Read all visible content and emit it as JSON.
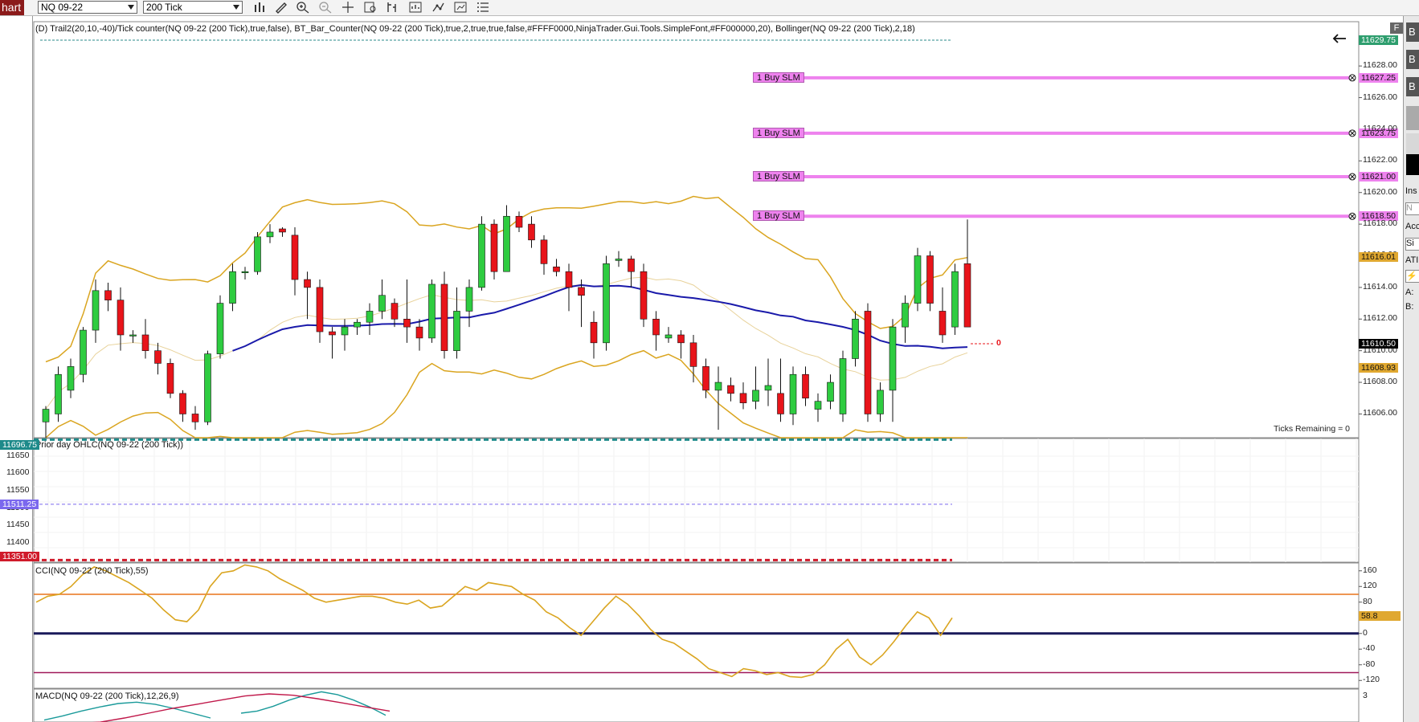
{
  "toolbar": {
    "tab_label": "hart",
    "instrument": "NQ 09-22",
    "interval": "200 Tick"
  },
  "main_panel": {
    "legend": "(D) Trail2(20,10,-40)/Tick counter(NQ 09-22 (200 Tick),true,false), BT_Bar_Counter(NQ 09-22 (200 Tick),true,2,true,true,false,#FFFF0000,NinjaTrader.Gui.Tools.SimpleFont,#FF000000,20), Bollinger(NQ 09-22 (200 Tick),2,18)",
    "ticks_remaining": "Ticks Remaining = 0",
    "bar_counter": "0",
    "orders": [
      {
        "label": "1 Buy SLM",
        "price": 11627.25,
        "tag": "11627.25"
      },
      {
        "label": "1 Buy SLM",
        "price": 11623.75,
        "tag": "11623.75"
      },
      {
        "label": "1 Buy SLM",
        "price": 11621.0,
        "tag": "11621.00"
      },
      {
        "label": "1 Buy SLM",
        "price": 11618.5,
        "tag": "11618.50"
      }
    ],
    "price_tags": {
      "top": "11629.75",
      "upper_band": "11616.01",
      "last": "11610.50",
      "lower_band": "11608.93"
    },
    "axis_ticks": [
      "11628.00",
      "11626.00",
      "11624.00",
      "11622.00",
      "11620.00",
      "11618.00",
      "11616.00",
      "11614.00",
      "11612.00",
      "11610.00",
      "11608.00",
      "11606.00"
    ],
    "colors": {
      "up": "#2ecc40",
      "down": "#e8141a",
      "band": "#daa520",
      "ma": "#1a1aaa",
      "order_line": "#ee82ee"
    }
  },
  "ohlc_panel": {
    "legend": "Prior day OHLC(NQ 09-22 (200 Tick))",
    "tags": {
      "high": "11696.75",
      "mid": "11511.25",
      "low": "11351.00"
    },
    "axis_ticks": [
      "11650",
      "11600",
      "11550",
      "11500",
      "11450",
      "11400"
    ]
  },
  "cci_panel": {
    "legend": "CCI(NQ 09-22 (200 Tick),55)",
    "value_tag": "58.8",
    "axis_ticks": [
      "160",
      "120",
      "80",
      "40",
      "0",
      "-40",
      "-80",
      "-120"
    ]
  },
  "macd_panel": {
    "legend": "MACD(NQ 09-22 (200 Tick),12,26,9)",
    "axis_ticks": [
      "3"
    ]
  },
  "right_panel": {
    "buttons": [
      "B",
      "B",
      "B"
    ],
    "labels": [
      "Ins",
      "N",
      "Acc",
      "Si",
      "ATI",
      "A:",
      "B:"
    ]
  },
  "chart_data": {
    "type": "candlestick",
    "candles": [
      {
        "o": 11605.5,
        "h": 11606.5,
        "l": 11604.5,
        "c": 11606.3
      },
      {
        "o": 11606,
        "h": 11609,
        "l": 11605.5,
        "c": 11608.5
      },
      {
        "o": 11607.5,
        "h": 11609.5,
        "l": 11607,
        "c": 11609
      },
      {
        "o": 11608.5,
        "h": 11611.5,
        "l": 11608,
        "c": 11611.3
      },
      {
        "o": 11611.3,
        "h": 11614.5,
        "l": 11610.5,
        "c": 11613.8
      },
      {
        "o": 11613.8,
        "h": 11614.3,
        "l": 11612.5,
        "c": 11613.2
      },
      {
        "o": 11613.2,
        "h": 11614,
        "l": 11610,
        "c": 11611
      },
      {
        "o": 11611,
        "h": 11611.3,
        "l": 11610.5,
        "c": 11611
      },
      {
        "o": 11611,
        "h": 11612,
        "l": 11609.5,
        "c": 11610
      },
      {
        "o": 11610,
        "h": 11610.5,
        "l": 11608.5,
        "c": 11609.2
      },
      {
        "o": 11609.2,
        "h": 11609.5,
        "l": 11607,
        "c": 11607.3
      },
      {
        "o": 11607.3,
        "h": 11607.5,
        "l": 11605.5,
        "c": 11606
      },
      {
        "o": 11606,
        "h": 11606.5,
        "l": 11605,
        "c": 11605.5
      },
      {
        "o": 11605.5,
        "h": 11610,
        "l": 11605.3,
        "c": 11609.8
      },
      {
        "o": 11609.8,
        "h": 11613.5,
        "l": 11609.5,
        "c": 11613
      },
      {
        "o": 11613,
        "h": 11615.5,
        "l": 11612.5,
        "c": 11615
      },
      {
        "o": 11615,
        "h": 11615.3,
        "l": 11614.5,
        "c": 11615
      },
      {
        "o": 11615,
        "h": 11617.5,
        "l": 11614.8,
        "c": 11617.2
      },
      {
        "o": 11617.2,
        "h": 11618,
        "l": 11616.8,
        "c": 11617.5
      },
      {
        "o": 11617.7,
        "h": 11617.8,
        "l": 11617.2,
        "c": 11617.5
      },
      {
        "o": 11617.3,
        "h": 11617.8,
        "l": 11613.5,
        "c": 11614.5
      },
      {
        "o": 11614.5,
        "h": 11615,
        "l": 11612,
        "c": 11614
      },
      {
        "o": 11614,
        "h": 11614.5,
        "l": 11610.5,
        "c": 11611.2
      },
      {
        "o": 11611.2,
        "h": 11611.5,
        "l": 11609.5,
        "c": 11611
      },
      {
        "o": 11611,
        "h": 11612,
        "l": 11610,
        "c": 11611.5
      },
      {
        "o": 11611.5,
        "h": 11612,
        "l": 11611,
        "c": 11611.8
      },
      {
        "o": 11611.8,
        "h": 11613,
        "l": 11611,
        "c": 11612.5
      },
      {
        "o": 11612.5,
        "h": 11614.5,
        "l": 11612,
        "c": 11613.5
      },
      {
        "o": 11613,
        "h": 11613.3,
        "l": 11611.5,
        "c": 11612
      },
      {
        "o": 11612,
        "h": 11614.5,
        "l": 11610.5,
        "c": 11611.5
      },
      {
        "o": 11611.5,
        "h": 11612,
        "l": 11610,
        "c": 11610.8
      },
      {
        "o": 11610.8,
        "h": 11614.5,
        "l": 11610.5,
        "c": 11614.2
      },
      {
        "o": 11614.2,
        "h": 11615,
        "l": 11609.5,
        "c": 11610
      },
      {
        "o": 11610,
        "h": 11614,
        "l": 11609.5,
        "c": 11612.5
      },
      {
        "o": 11612.5,
        "h": 11614.5,
        "l": 11611.5,
        "c": 11614
      },
      {
        "o": 11614,
        "h": 11618.5,
        "l": 11613.8,
        "c": 11618
      },
      {
        "o": 11618,
        "h": 11618.3,
        "l": 11614.5,
        "c": 11615
      },
      {
        "o": 11615,
        "h": 11619.2,
        "l": 11615,
        "c": 11618.5
      },
      {
        "o": 11618.5,
        "h": 11618.8,
        "l": 11617.5,
        "c": 11617.8
      },
      {
        "o": 11618,
        "h": 11618.5,
        "l": 11616.5,
        "c": 11617
      },
      {
        "o": 11617,
        "h": 11617.3,
        "l": 11614.8,
        "c": 11615.5
      },
      {
        "o": 11615.3,
        "h": 11615.8,
        "l": 11614.7,
        "c": 11615
      },
      {
        "o": 11615,
        "h": 11615.5,
        "l": 11612.5,
        "c": 11614
      },
      {
        "o": 11614,
        "h": 11614.5,
        "l": 11611.5,
        "c": 11613.5
      },
      {
        "o": 11611.8,
        "h": 11612.5,
        "l": 11609.5,
        "c": 11610.5
      },
      {
        "o": 11610.5,
        "h": 11616,
        "l": 11610,
        "c": 11615.5
      },
      {
        "o": 11615.7,
        "h": 11616.3,
        "l": 11615.3,
        "c": 11615.8
      },
      {
        "o": 11615.8,
        "h": 11616,
        "l": 11614,
        "c": 11615
      },
      {
        "o": 11615,
        "h": 11615.5,
        "l": 11611.5,
        "c": 11612
      },
      {
        "o": 11612,
        "h": 11612.5,
        "l": 11610,
        "c": 11611
      },
      {
        "o": 11610.8,
        "h": 11611.5,
        "l": 11610.5,
        "c": 11611
      },
      {
        "o": 11611,
        "h": 11611.3,
        "l": 11609.5,
        "c": 11610.5
      },
      {
        "o": 11610.5,
        "h": 11611,
        "l": 11608,
        "c": 11609
      },
      {
        "o": 11609,
        "h": 11609.5,
        "l": 11607,
        "c": 11607.5
      },
      {
        "o": 11607.5,
        "h": 11609,
        "l": 11605,
        "c": 11608
      },
      {
        "o": 11607.8,
        "h": 11608.3,
        "l": 11606.8,
        "c": 11607.3
      },
      {
        "o": 11607.3,
        "h": 11608,
        "l": 11606.3,
        "c": 11606.7
      },
      {
        "o": 11606.8,
        "h": 11609,
        "l": 11606.3,
        "c": 11607.5
      },
      {
        "o": 11607.5,
        "h": 11609.5,
        "l": 11606.5,
        "c": 11607.8
      },
      {
        "o": 11607.3,
        "h": 11609.5,
        "l": 11605.5,
        "c": 11606
      },
      {
        "o": 11606,
        "h": 11609,
        "l": 11605.3,
        "c": 11608.5
      },
      {
        "o": 11608.5,
        "h": 11609,
        "l": 11606.5,
        "c": 11607
      },
      {
        "o": 11606.3,
        "h": 11607.3,
        "l": 11605.5,
        "c": 11606.8
      },
      {
        "o": 11606.8,
        "h": 11608.5,
        "l": 11606.3,
        "c": 11608
      },
      {
        "o": 11606,
        "h": 11610,
        "l": 11605.5,
        "c": 11609.5
      },
      {
        "o": 11609.5,
        "h": 11612.5,
        "l": 11609,
        "c": 11612
      },
      {
        "o": 11612.5,
        "h": 11613,
        "l": 11605.5,
        "c": 11606
      },
      {
        "o": 11606,
        "h": 11608,
        "l": 11605.5,
        "c": 11607.5
      },
      {
        "o": 11607.5,
        "h": 11612,
        "l": 11605.5,
        "c": 11611.5
      },
      {
        "o": 11611.5,
        "h": 11613.5,
        "l": 11610.5,
        "c": 11613
      },
      {
        "o": 11613,
        "h": 11616.5,
        "l": 11612.5,
        "c": 11616
      },
      {
        "o": 11616,
        "h": 11616.3,
        "l": 11612.5,
        "c": 11613
      },
      {
        "o": 11612.5,
        "h": 11614,
        "l": 11610.5,
        "c": 11611
      },
      {
        "o": 11611.5,
        "h": 11615.5,
        "l": 11611,
        "c": 11615
      },
      {
        "o": 11615.5,
        "h": 11618.3,
        "l": 11611.5,
        "c": 11611.5
      }
    ],
    "price_range": [
      11604.5,
      11630.8
    ]
  }
}
